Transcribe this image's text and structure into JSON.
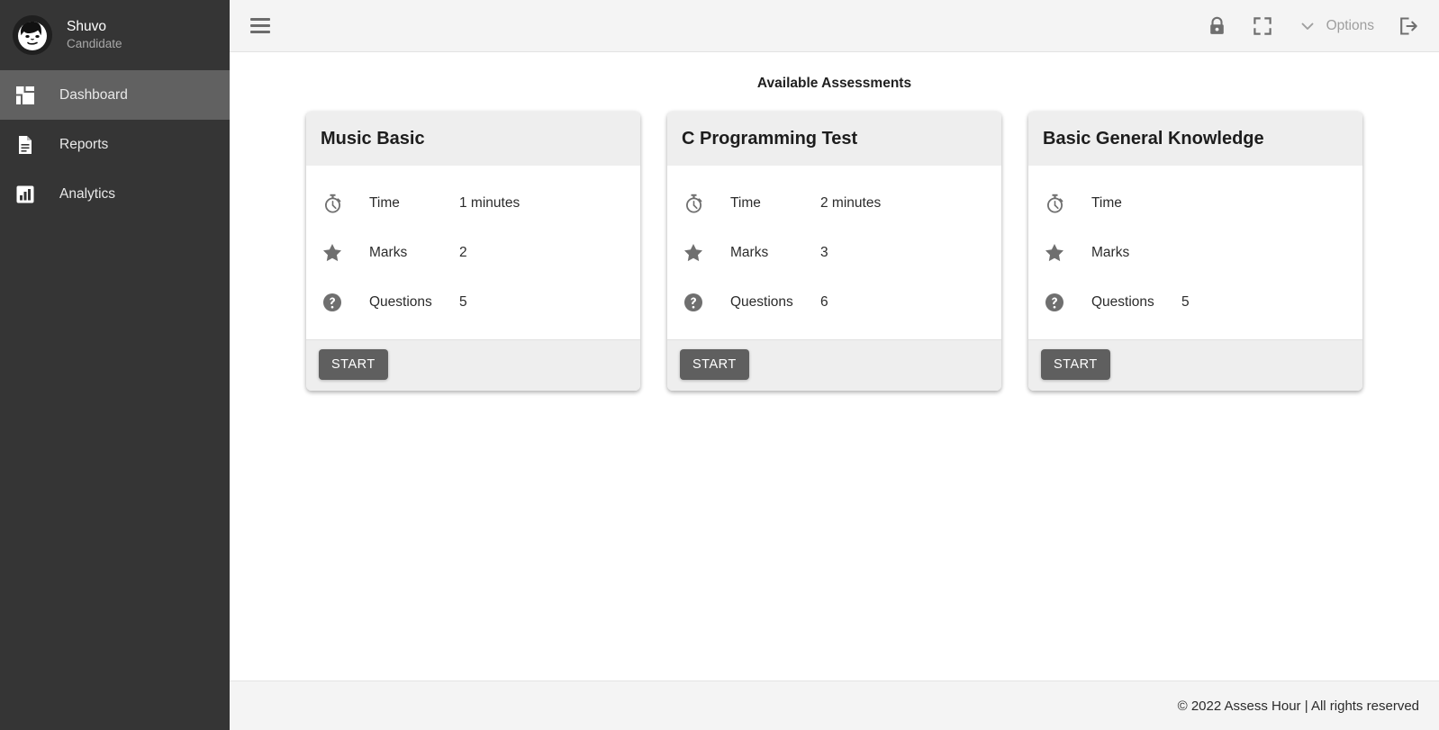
{
  "sidebar": {
    "profile": {
      "avatar_icon": "user-avatar-face",
      "name": "Shuvo",
      "role": "Candidate"
    },
    "items": [
      {
        "label": "Dashboard",
        "icon": "dashboard-grid-icon",
        "active": true
      },
      {
        "label": "Reports",
        "icon": "document-icon",
        "active": false
      },
      {
        "label": "Analytics",
        "icon": "bar-chart-icon",
        "active": false
      }
    ],
    "bg_color": "#353535",
    "active_color": "#616161"
  },
  "topbar": {
    "menu_icon": "hamburger-menu-icon",
    "lock_icon": "lock-icon",
    "fullscreen_icon": "fullscreen-icon",
    "chevron_icon": "chevron-down-icon",
    "options_label": "Options",
    "logout_icon": "logout-icon",
    "bg_color": "#f4f4f4"
  },
  "main": {
    "section_title": "Available Assessments",
    "stat_icons": {
      "time": "stopwatch-icon",
      "marks": "star-icon",
      "questions": "question-circle-icon"
    },
    "stat_labels": {
      "time": "Time",
      "marks": "Marks",
      "questions": "Questions"
    },
    "start_label": "START",
    "cards": [
      {
        "title": "Music Basic",
        "time": "1 minutes",
        "marks": "2",
        "questions": "5"
      },
      {
        "title": "C Programming Test",
        "time": "2 minutes",
        "marks": "3",
        "questions": "6"
      },
      {
        "title": "Basic General Knowledge",
        "time": "",
        "marks": "",
        "questions": "5"
      }
    ]
  },
  "footer": {
    "copyright": "© 2022 Assess Hour | All rights reserved"
  }
}
